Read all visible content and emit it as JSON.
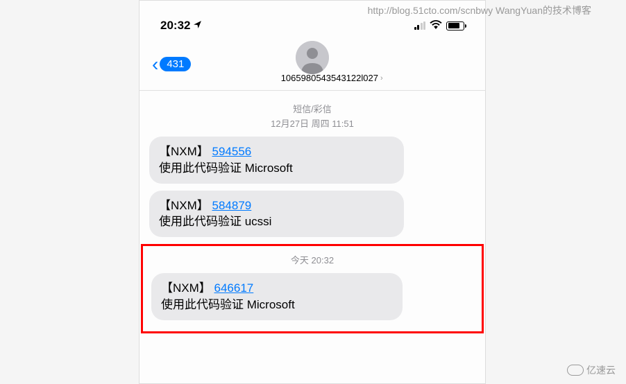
{
  "watermark": {
    "top": "http://blog.51cto.com/scnbwy WangYuan的技术博客",
    "bottom": "亿速云"
  },
  "status": {
    "time": "20:32",
    "location_icon": "◢"
  },
  "nav": {
    "back_badge": "431",
    "contact": "1065980543543122l027",
    "chevron": "›"
  },
  "section1": {
    "type_label": "短信/彩信",
    "date": "12月27日 周四 11:51"
  },
  "messages": [
    {
      "prefix": "【NXM】",
      "code": "594556",
      "body": "使用此代码验证 Microsoft"
    },
    {
      "prefix": "【NXM】",
      "code": "584879",
      "body": "使用此代码验证 ucssi"
    }
  ],
  "section2": {
    "label": "今天 20:32"
  },
  "message3": {
    "prefix": "【NXM】",
    "code": "646617",
    "body": "使用此代码验证 Microsoft"
  }
}
